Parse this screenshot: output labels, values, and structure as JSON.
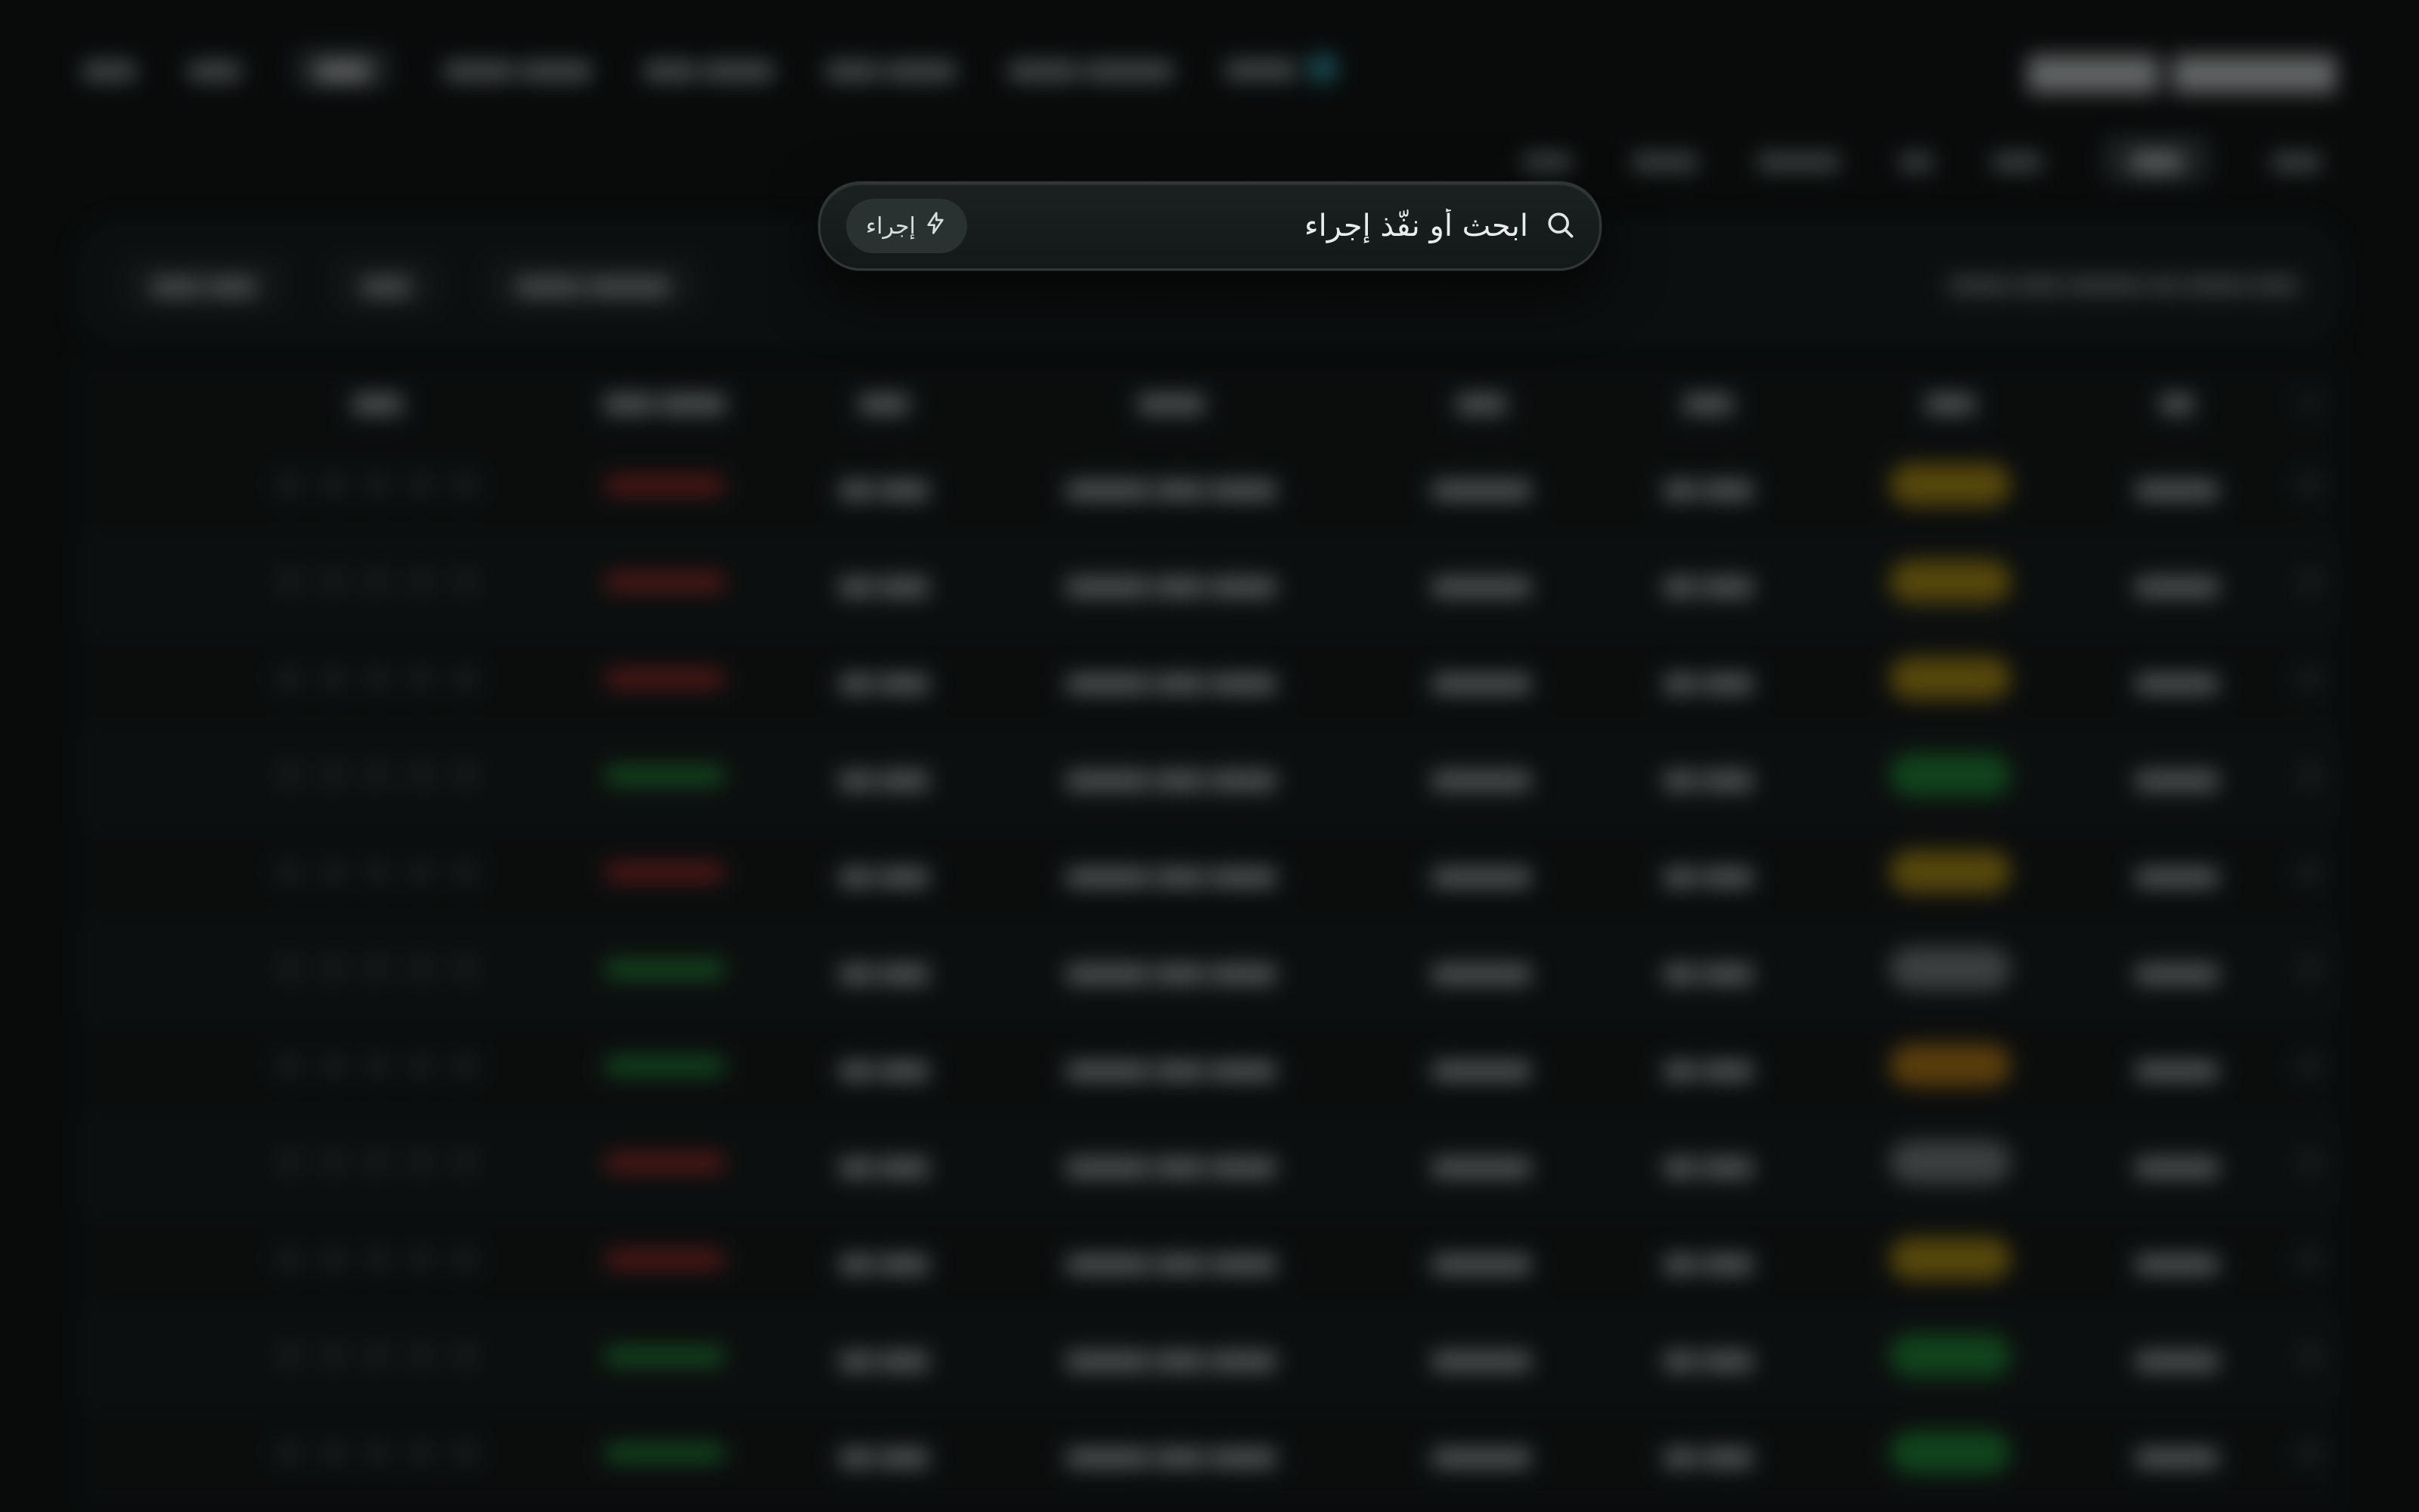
{
  "palette": {
    "placeholder": "ابحث أو نفّذ إجراء",
    "action_label": "إجراء",
    "search_icon": "search-icon",
    "action_icon": "bolt-icon"
  },
  "colors": {
    "status_yellow": "#c8a010",
    "status_green": "#1f9a3a",
    "status_gray": "#8a9090",
    "status_orange": "#d08a10",
    "trend_red": "#c0302a",
    "trend_green": "#27a840",
    "presence": "#38b0c0"
  },
  "rows": [
    {
      "status": "yellow",
      "trend": "red"
    },
    {
      "status": "yellow",
      "trend": "red"
    },
    {
      "status": "yellow",
      "trend": "red"
    },
    {
      "status": "green",
      "trend": "green"
    },
    {
      "status": "yellow",
      "trend": "red"
    },
    {
      "status": "gray",
      "trend": "green"
    },
    {
      "status": "orange",
      "trend": "green"
    },
    {
      "status": "gray",
      "trend": "red"
    },
    {
      "status": "yellow",
      "trend": "red"
    },
    {
      "status": "green",
      "trend": "green"
    },
    {
      "status": "green",
      "trend": "green"
    }
  ]
}
